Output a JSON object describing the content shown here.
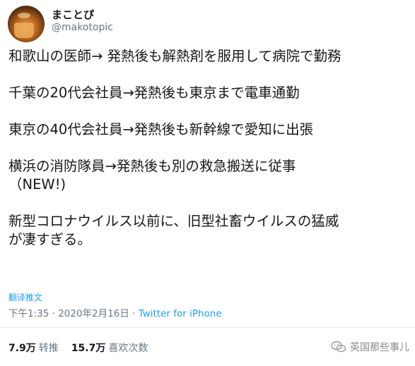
{
  "user": {
    "display_name": "まことぴ",
    "handle": "@makotopic"
  },
  "tweet": {
    "lines": [
      "和歌山の医師→ 発熱後も解熱剤を服用して病院で勤務",
      "",
      "千葉の20代会社員→発熱後も東京まで電車通勤",
      "",
      "東京の40代会社員→発熱後も新幹線で愛知に出張",
      "",
      "横浜の消防隊員→発熱後も別の救急搬送に従事",
      "（NEW!)",
      "",
      "新型コロナウイルス以前に、旧型社畜ウイルスの猛威",
      "が凄すぎる。"
    ],
    "translate_label": "翻译推文",
    "timestamp": "下午1:35 · 2020年2月16日",
    "separator": " · ",
    "source": "Twitter for iPhone"
  },
  "stats": {
    "retweets_count": "7.9万",
    "retweets_label": "转推",
    "likes_count": "15.7万",
    "likes_label": "喜欢次数"
  },
  "watermark": {
    "text": "英国那些事儿",
    "icon": "wechat-icon"
  },
  "colors": {
    "link": "#1da1f2",
    "secondary_text": "#657786",
    "primary_text": "#14171a",
    "divider": "#e6ecf0"
  }
}
